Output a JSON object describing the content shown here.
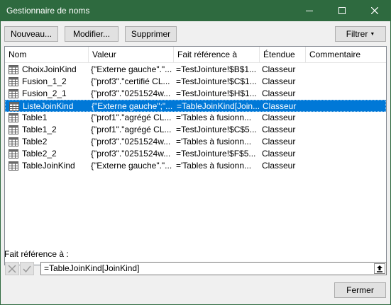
{
  "window": {
    "title": "Gestionnaire de noms"
  },
  "toolbar": {
    "new_label": "Nouveau...",
    "edit_label": "Modifier...",
    "delete_label": "Supprimer",
    "filter_label": "Filtrer"
  },
  "columns": {
    "name": "Nom",
    "value": "Valeur",
    "ref": "Fait référence à",
    "scope": "Étendue",
    "comment": "Commentaire"
  },
  "rows": [
    {
      "name": "ChoixJoinKind",
      "value": "{\"Externe gauche\".\"...",
      "ref": "=TestJointure!$B$1...",
      "scope": "Classeur",
      "comment": "",
      "selected": false
    },
    {
      "name": "Fusion_1_2",
      "value": "{\"prof3\".\"certifié CL...",
      "ref": "=TestJointure!$C$1...",
      "scope": "Classeur",
      "comment": "",
      "selected": false
    },
    {
      "name": "Fusion_2_1",
      "value": "{\"prof3\".\"0251524w...",
      "ref": "=TestJointure!$H$1...",
      "scope": "Classeur",
      "comment": "",
      "selected": false
    },
    {
      "name": "ListeJoinKind",
      "value": "{\"Externe gauche\";\"...",
      "ref": "=TableJoinKind[Join...",
      "scope": "Classeur",
      "comment": "",
      "selected": true
    },
    {
      "name": "Table1",
      "value": "{\"prof1\".\"agrégé CL...",
      "ref": "='Tables à fusionn...",
      "scope": "Classeur",
      "comment": "",
      "selected": false
    },
    {
      "name": "Table1_2",
      "value": "{\"prof1\".\"agrégé CL...",
      "ref": "=TestJointure!$C$5...",
      "scope": "Classeur",
      "comment": "",
      "selected": false
    },
    {
      "name": "Table2",
      "value": "{\"prof3\".\"0251524w...",
      "ref": "='Tables à fusionn...",
      "scope": "Classeur",
      "comment": "",
      "selected": false
    },
    {
      "name": "Table2_2",
      "value": "{\"prof3\".\"0251524w...",
      "ref": "=TestJointure!$F$5...",
      "scope": "Classeur",
      "comment": "",
      "selected": false
    },
    {
      "name": "TableJoinKind",
      "value": "{\"Externe gauche\".\"...",
      "ref": "='Tables à fusionn...",
      "scope": "Classeur",
      "comment": "",
      "selected": false
    }
  ],
  "reference": {
    "label": "Fait référence à :",
    "value": "=TableJoinKind[JoinKind]"
  },
  "footer": {
    "close_label": "Fermer"
  },
  "colors": {
    "titlebar": "#2e6a3f",
    "selection": "#0078d7"
  },
  "icons": {
    "table": "table-icon",
    "cancel": "cancel-x-icon",
    "confirm": "checkmark-icon",
    "collapse": "collapse-arrow-icon"
  }
}
